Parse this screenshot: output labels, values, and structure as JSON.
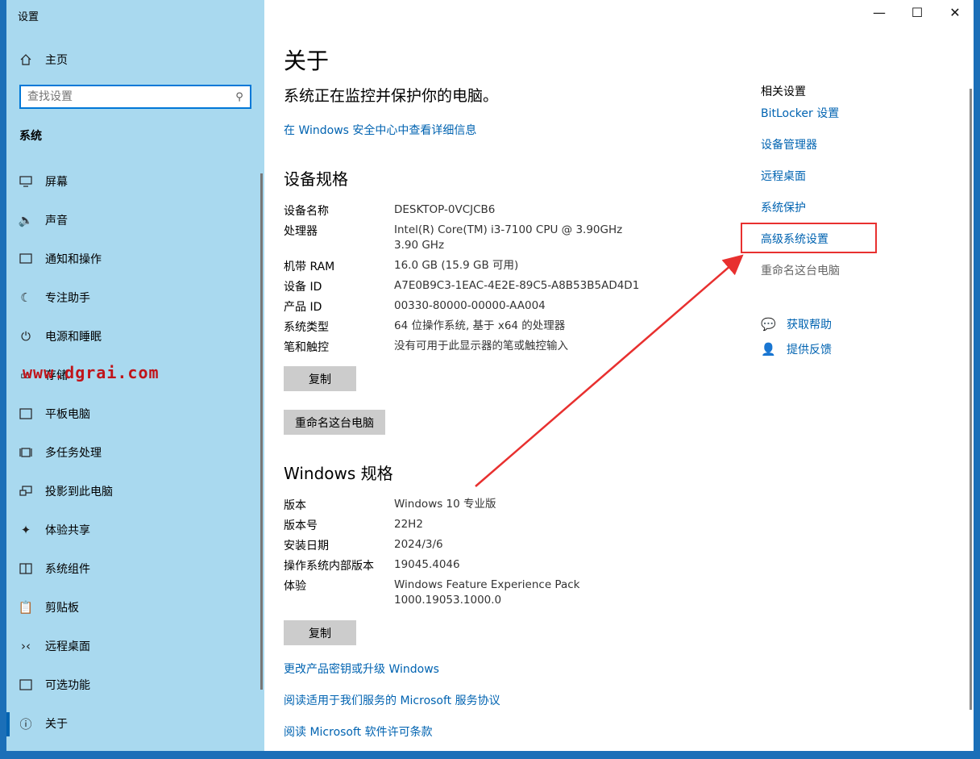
{
  "window": {
    "title": "设置"
  },
  "sidebar": {
    "home": {
      "label": "主页",
      "icon": "home-icon"
    },
    "search_placeholder": "查找设置",
    "section": "系统",
    "items": [
      {
        "label": "屏幕",
        "icon": "monitor-icon"
      },
      {
        "label": "声音",
        "icon": "speaker-icon"
      },
      {
        "label": "通知和操作",
        "icon": "notification-icon"
      },
      {
        "label": "专注助手",
        "icon": "moon-icon"
      },
      {
        "label": "电源和睡眠",
        "icon": "power-icon"
      },
      {
        "label": "存储",
        "icon": "storage-icon"
      },
      {
        "label": "平板电脑",
        "icon": "tablet-icon"
      },
      {
        "label": "多任务处理",
        "icon": "multitask-icon"
      },
      {
        "label": "投影到此电脑",
        "icon": "project-icon"
      },
      {
        "label": "体验共享",
        "icon": "share-icon"
      },
      {
        "label": "系统组件",
        "icon": "components-icon"
      },
      {
        "label": "剪贴板",
        "icon": "clipboard-icon"
      },
      {
        "label": "远程桌面",
        "icon": "remote-icon"
      },
      {
        "label": "可选功能",
        "icon": "features-icon"
      },
      {
        "label": "关于",
        "icon": "info-icon"
      }
    ],
    "watermark": "www.dgrai.com"
  },
  "main": {
    "title": "关于",
    "status": "系统正在监控并保护你的电脑。",
    "security_link": "在 Windows 安全中心中查看详细信息",
    "device_heading": "设备规格",
    "device_specs": [
      {
        "label": "设备名称",
        "value": "DESKTOP-0VCJCB6"
      },
      {
        "label": "处理器",
        "value": "Intel(R) Core(TM) i3-7100 CPU @ 3.90GHz   3.90 GHz"
      },
      {
        "label": "机带 RAM",
        "value": "16.0 GB (15.9 GB 可用)"
      },
      {
        "label": "设备 ID",
        "value": "A7E0B9C3-1EAC-4E2E-89C5-A8B53B5AD4D1"
      },
      {
        "label": "产品 ID",
        "value": "00330-80000-00000-AA004"
      },
      {
        "label": "系统类型",
        "value": "64 位操作系统, 基于 x64 的处理器"
      },
      {
        "label": "笔和触控",
        "value": "没有可用于此显示器的笔或触控输入"
      }
    ],
    "copy_label": "复制",
    "rename_label": "重命名这台电脑",
    "windows_heading": "Windows 规格",
    "windows_specs": [
      {
        "label": "版本",
        "value": "Windows 10 专业版"
      },
      {
        "label": "版本号",
        "value": "22H2"
      },
      {
        "label": "安装日期",
        "value": "2024/3/6"
      },
      {
        "label": "操作系统内部版本",
        "value": "19045.4046"
      },
      {
        "label": "体验",
        "value": "Windows Feature Experience Pack 1000.19053.1000.0"
      }
    ],
    "copy2_label": "复制",
    "links": [
      "更改产品密钥或升级 Windows",
      "阅读适用于我们服务的 Microsoft 服务协议",
      "阅读 Microsoft 软件许可条款"
    ]
  },
  "related": {
    "title": "相关设置",
    "links": [
      "BitLocker 设置",
      "设备管理器",
      "远程桌面",
      "系统保护",
      "高级系统设置"
    ],
    "rename": "重命名这台电脑",
    "help": "获取帮助",
    "feedback": "提供反馈"
  },
  "colors": {
    "accent": "#0063b1",
    "sidebar": "#a9d9ef",
    "highlight": "#e8302f"
  }
}
